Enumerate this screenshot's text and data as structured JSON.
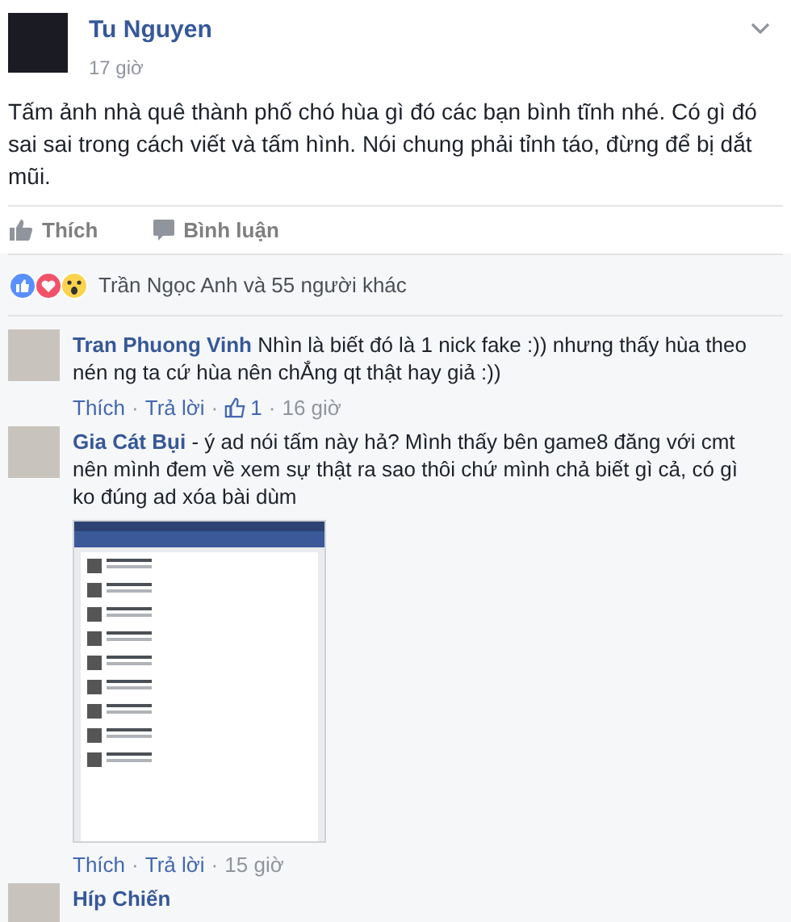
{
  "post": {
    "author": "Tu Nguyen",
    "time": "17 giờ",
    "text": "Tấm ảnh nhà quê thành phố chó hùa gì đó các bạn bình tĩnh nhé. Có gì đó sai sai trong cách viết và tấm hình. Nói chung phải tỉnh táo, đừng để bị dắt mũi.",
    "actions": [
      {
        "kind": "like",
        "label": "Thích"
      },
      {
        "kind": "comment",
        "label": "Bình luận"
      }
    ]
  },
  "reactions": {
    "summary": "Trần Ngọc Anh và 55 người khác"
  },
  "comments": [
    {
      "author": "Tran Phuong Vinh",
      "text": "Nhìn là biết đó là 1 nick fake :)) nhưng thấy hùa theo nén ng ta cứ hùa nên chẮng qt thật hay giả :))",
      "actions": [
        "Thích",
        "Trả lời"
      ],
      "separator": "·",
      "likes": "1",
      "time": "16 giờ"
    },
    {
      "author": "Gia Cát Bụi",
      "text": "- ý ad nói tấm này hả? Mình thấy bên game8 đăng với cmt nên mình đem về xem sự thật ra sao thôi chứ mình chả biết gì cả, có gì ko đúng ad xóa bài dùm",
      "attachment": {
        "kind": "screenshot"
      },
      "actions": [
        "Thích",
        "Trả lời"
      ],
      "separator": "·",
      "time": "15 giờ"
    },
    {
      "author": "Híp Chiến"
    }
  ]
}
